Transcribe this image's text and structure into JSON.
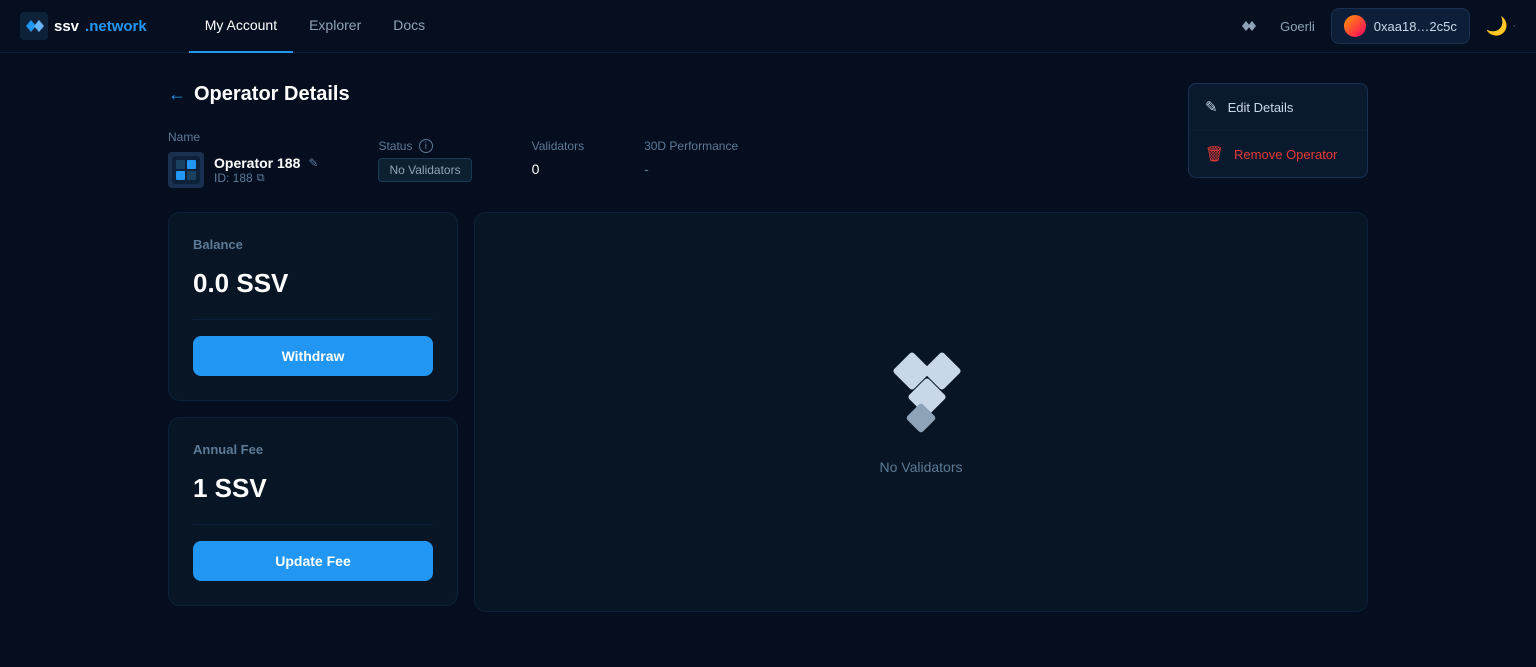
{
  "nav": {
    "logo_name": "ssv",
    "logo_dot": ".network",
    "links": [
      {
        "label": "My Account",
        "active": true
      },
      {
        "label": "Explorer",
        "active": false
      },
      {
        "label": "Docs",
        "active": false
      }
    ],
    "network": "Goerli",
    "wallet_address": "0xaa18…2c5c",
    "theme_icon": "🌙"
  },
  "page": {
    "back_label": "Operator Details",
    "name_label": "Name",
    "status_label": "Status",
    "validators_label": "Validators",
    "performance_label": "30D Performance",
    "operator_name": "Operator 188",
    "operator_id": "ID: 188",
    "status_badge": "No Validators",
    "validators_value": "0",
    "performance_value": "-"
  },
  "dropdown": {
    "edit_label": "Edit Details",
    "remove_label": "Remove Operator"
  },
  "balance_card": {
    "title": "Balance",
    "value": "0.0 SSV",
    "withdraw_label": "Withdraw"
  },
  "fee_card": {
    "title": "Annual Fee",
    "value": "1 SSV",
    "update_label": "Update Fee"
  },
  "validators_panel": {
    "empty_text": "No Validators"
  }
}
